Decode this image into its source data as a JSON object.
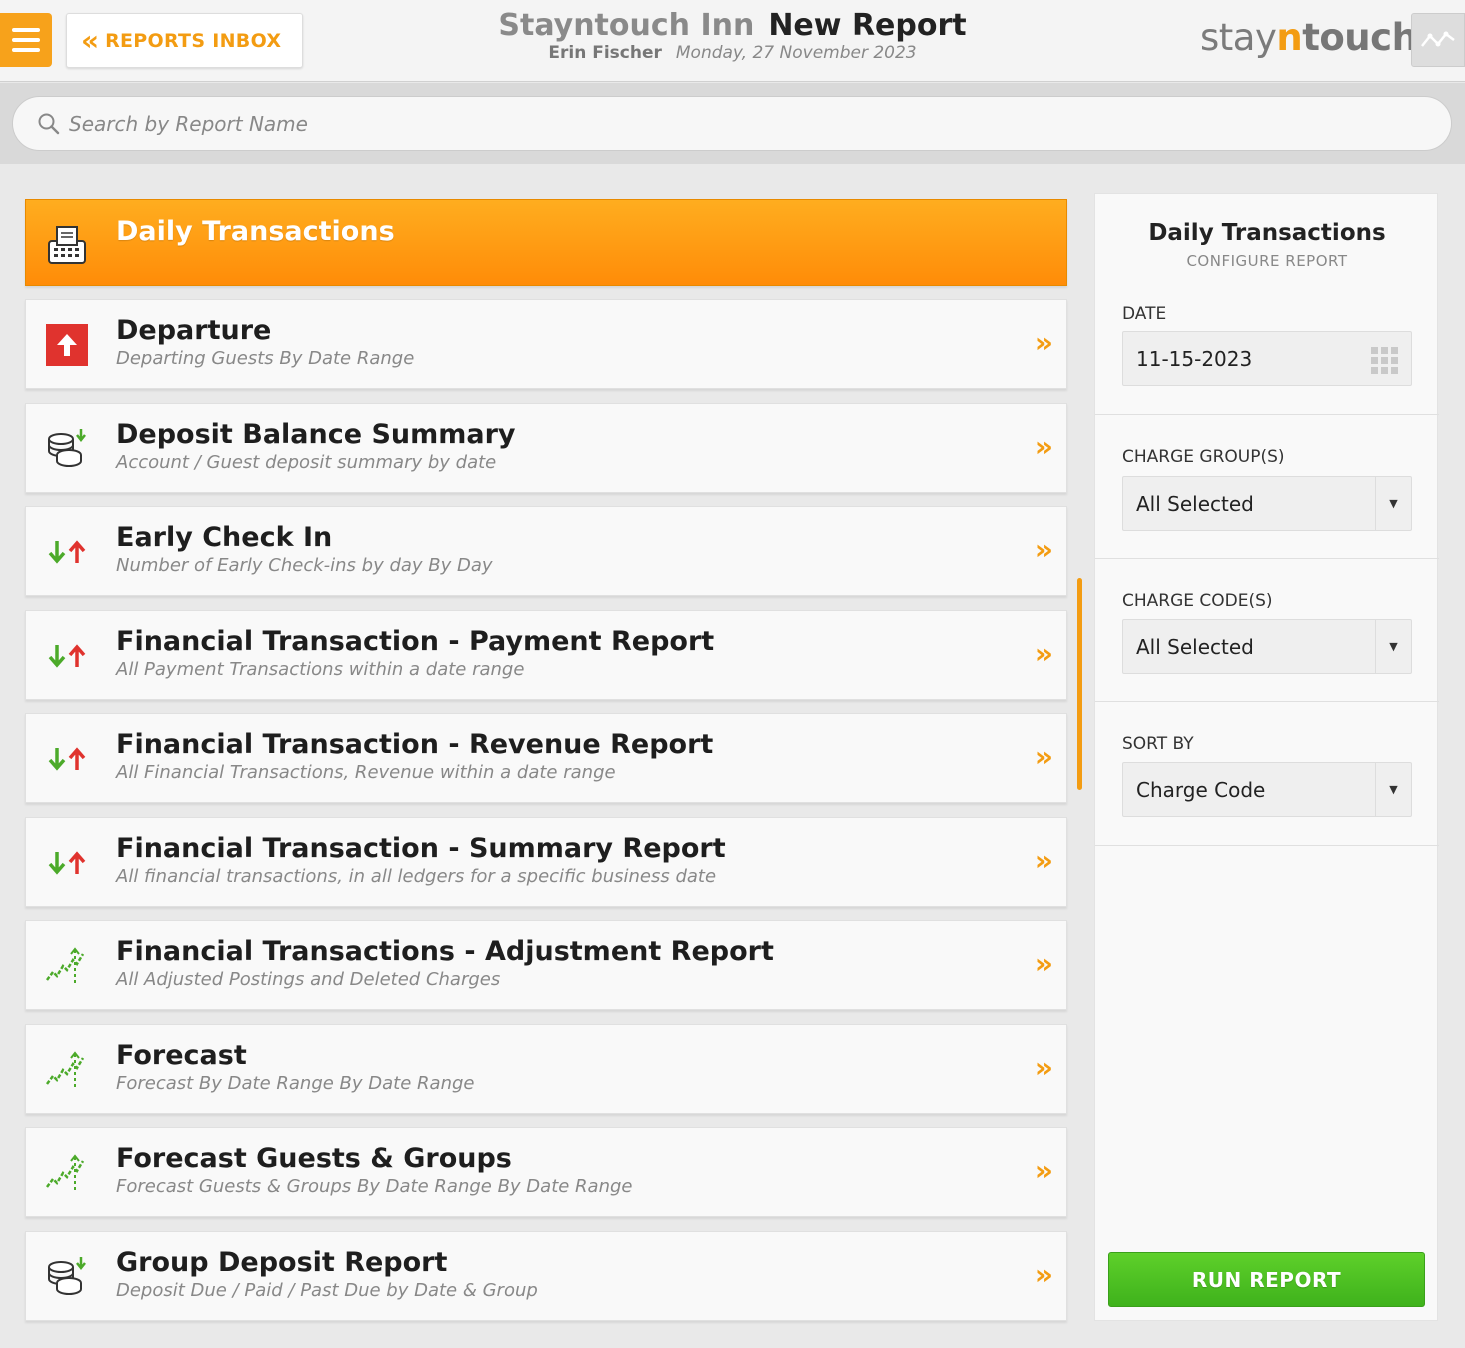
{
  "header": {
    "back_label": "REPORTS INBOX",
    "hotel_name": "Stayntouch Inn",
    "page_title": "New Report",
    "user_name": "Erin Fischer",
    "date": "Monday, 27 November 2023",
    "brand_stay": "stay",
    "brand_n": "n",
    "brand_touch": "touch"
  },
  "search": {
    "placeholder": "Search by Report Name"
  },
  "reports": [
    {
      "name": "Daily Transactions",
      "desc": "",
      "icon": "cash-register-icon",
      "active": true
    },
    {
      "name": "Departure",
      "desc": "Departing Guests By Date Range",
      "icon": "departure-arrow-icon"
    },
    {
      "name": "Deposit Balance Summary",
      "desc": "Account / Guest deposit summary by date",
      "icon": "coins-deposit-icon"
    },
    {
      "name": "Early Check In",
      "desc": "Number of Early Check-ins by day By Day",
      "icon": "up-down-arrows-icon"
    },
    {
      "name": "Financial Transaction - Payment Report",
      "desc": "All Payment Transactions within a date range",
      "icon": "up-down-arrows-icon"
    },
    {
      "name": "Financial Transaction - Revenue Report",
      "desc": "All Financial Transactions, Revenue within a date range",
      "icon": "up-down-arrows-icon"
    },
    {
      "name": "Financial Transaction - Summary Report",
      "desc": "All financial transactions, in all ledgers for a specific business date",
      "icon": "up-down-arrows-icon"
    },
    {
      "name": "Financial Transactions - Adjustment Report",
      "desc": "All Adjusted Postings and Deleted Charges",
      "icon": "trend-chart-icon"
    },
    {
      "name": "Forecast",
      "desc": "Forecast By Date Range By Date Range",
      "icon": "trend-chart-icon"
    },
    {
      "name": "Forecast Guests & Groups",
      "desc": "Forecast Guests & Groups By Date Range By Date Range",
      "icon": "trend-chart-icon"
    },
    {
      "name": "Group Deposit Report",
      "desc": "Deposit Due / Paid / Past Due by Date & Group",
      "icon": "coins-deposit-icon"
    }
  ],
  "config": {
    "title": "Daily Transactions",
    "subtitle": "CONFIGURE REPORT",
    "date_label": "DATE",
    "date_value": "11-15-2023",
    "charge_groups_label": "CHARGE GROUP(S)",
    "charge_groups_value": "All Selected",
    "charge_codes_label": "CHARGE CODE(S)",
    "charge_codes_value": "All Selected",
    "sort_by_label": "SORT BY",
    "sort_by_value": "Charge Code",
    "run_label": "RUN REPORT"
  },
  "colors": {
    "accent": "#f39c12",
    "active_row": "#ff9a10",
    "run_button": "#4cc11f",
    "departure_red": "#e0332e",
    "arrow_green": "#4caa2a"
  }
}
